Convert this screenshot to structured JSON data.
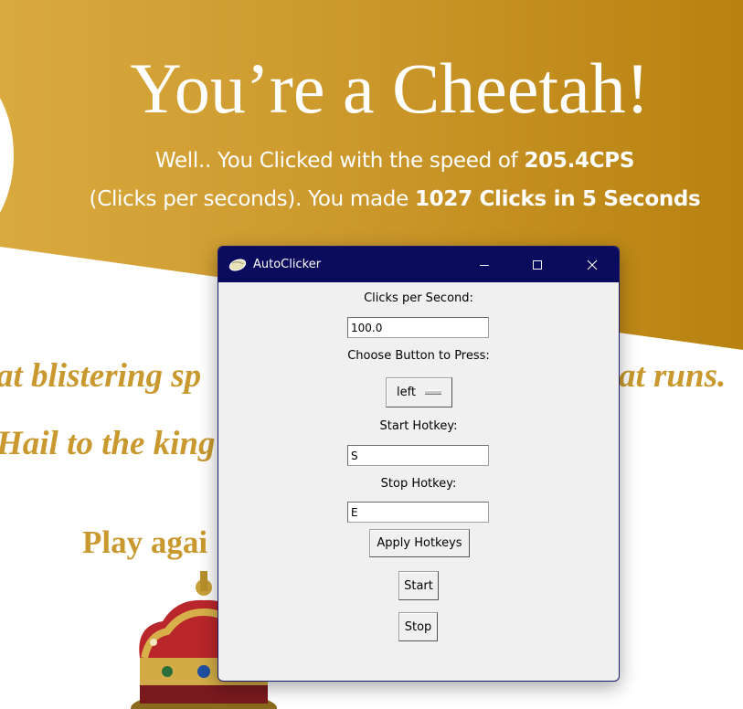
{
  "background_page": {
    "headline": "You’re a Cheetah!",
    "result_line1_text": "Well.. You Clicked with the speed of ",
    "result_line1_cps": "205.4CPS",
    "result_line2_text": "(Clicks per seconds). You made ",
    "result_line2_clicks": "1027 Clicks in 5 Seconds",
    "italic_line1_left": "at blistering sp",
    "italic_line1_right": "at runs.",
    "italic_line2": "Hail to the king",
    "play_again": "Play agai",
    "colors": {
      "gold": "#c9992f",
      "gold_dark": "#b98414"
    }
  },
  "window": {
    "title": "AutoClicker",
    "icon": "mouse-app-icon",
    "controls": [
      "minimize-icon",
      "maximize-icon",
      "close-icon"
    ],
    "titlebar_color": "#0b0b5e"
  },
  "form": {
    "cps_label": "Clicks per Second:",
    "cps_value": "100.0",
    "button_label": "Choose Button to Press:",
    "button_selected": "left",
    "start_hotkey_label": "Start Hotkey:",
    "start_hotkey_value": "S",
    "stop_hotkey_label": "Stop Hotkey:",
    "stop_hotkey_value": "E",
    "apply_label": "Apply Hotkeys",
    "start_label": "Start",
    "stop_label": "Stop"
  }
}
